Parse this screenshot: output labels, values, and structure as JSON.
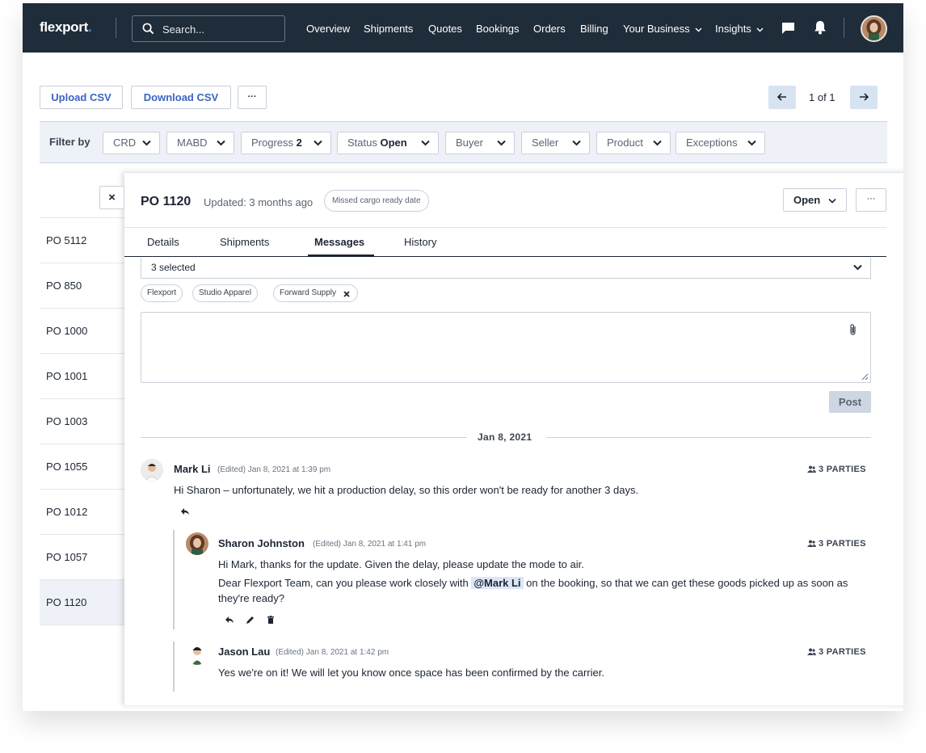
{
  "nav": {
    "logo": "flexport",
    "logo_dot": ".",
    "search_placeholder": "Search...",
    "links": [
      "Overview",
      "Shipments",
      "Quotes",
      "Bookings",
      "Orders",
      "Billing",
      "Your Business",
      "Insights"
    ]
  },
  "toolbar": {
    "upload_csv": "Upload CSV",
    "download_csv": "Download CSV",
    "more": "···",
    "prev_icon": "arrow-left-icon",
    "next_icon": "arrow-right-icon",
    "pagination": "1 of 1"
  },
  "filters": {
    "label": "Filter by",
    "chips": [
      {
        "label": "CRD",
        "value": ""
      },
      {
        "label": "MABD",
        "value": ""
      },
      {
        "label": "Progress",
        "value": "2"
      },
      {
        "label": "Status",
        "value": "Open"
      },
      {
        "label": "Buyer",
        "value": ""
      },
      {
        "label": "Seller",
        "value": ""
      },
      {
        "label": "Product",
        "value": ""
      },
      {
        "label": "Exceptions",
        "value": ""
      }
    ]
  },
  "po_list": [
    "PO 5112",
    "PO 850",
    "PO 1000",
    "PO 1001",
    "PO 1003",
    "PO 1055",
    "PO 1012",
    "PO 1057",
    "PO 1120"
  ],
  "selected_po": "PO 1120",
  "detail": {
    "close": "×",
    "title": "PO 1120",
    "updated": "Updated: 3 months ago",
    "badge": "Missed cargo ready date",
    "status_button": "Open",
    "more": "···",
    "tabs": [
      "Details",
      "Shipments",
      "Messages",
      "History"
    ],
    "active_tab": "Messages",
    "recipients": {
      "summary": "3 selected",
      "chips": [
        "Flexport",
        "Studio Apparel",
        "Forward Supply"
      ]
    },
    "post_button": "Post",
    "date_divider": "Jan 8, 2021"
  },
  "messages": [
    {
      "author": "Mark Li",
      "meta": "(Edited) Jan 8, 2021 at 1:39 pm",
      "parties": "3 PARTIES",
      "text": "Hi Sharon – unfortunately, we hit a production delay, so this order won't be ready for another 3 days."
    },
    {
      "author": "Sharon Johnston",
      "meta": "(Edited) Jan 8, 2021 at 1:41 pm",
      "parties": "3 PARTIES",
      "line1": "Hi Mark, thanks for the update. Given the delay, please update the mode to air.",
      "line2_before": "Dear Flexport Team, can you please work closely with ",
      "mention": "@Mark Li",
      "line2_after": " on the booking, so that we can get these goods picked up as soon as",
      "line3": "they're ready?"
    },
    {
      "author": "Jason Lau",
      "meta": "(Edited) Jan 8, 2021 at 1:42 pm",
      "parties": "3 PARTIES",
      "text": "Yes we're on it! We will let you know once space has been confirmed by the carrier."
    }
  ],
  "colors": {
    "nav_bg": "#1f2c3a",
    "accent": "#3b63c4",
    "filter_bg": "#eef2f8"
  }
}
